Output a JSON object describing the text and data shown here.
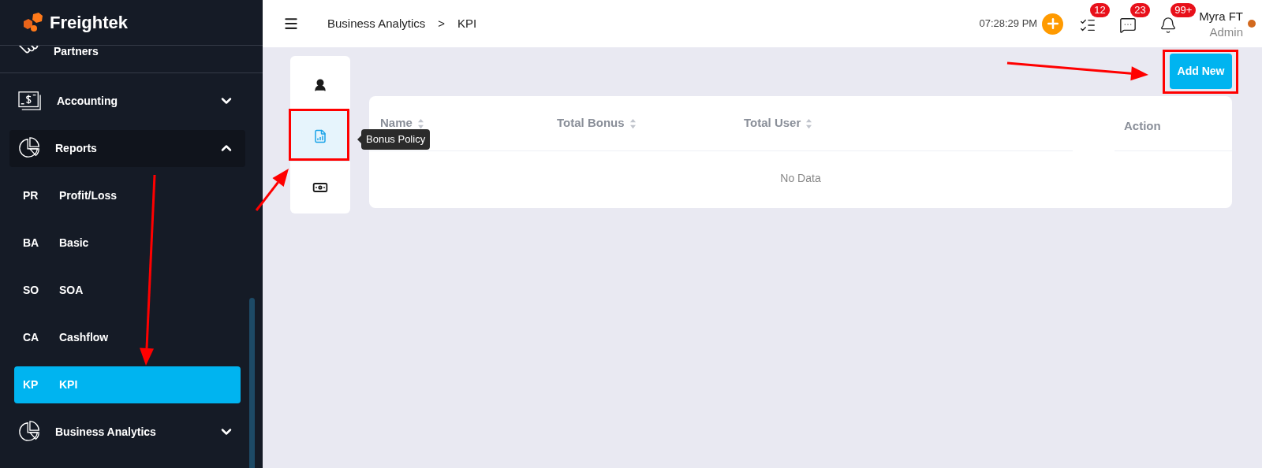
{
  "sidebar": {
    "logo": "Freightek",
    "items": [
      {
        "label": "Partners"
      },
      {
        "label": "Accounting",
        "expanded": false
      },
      {
        "label": "Reports",
        "expanded": true,
        "children": [
          {
            "abbr": "PR",
            "label": "Profit/Loss",
            "selected": false
          },
          {
            "abbr": "BA",
            "label": "Basic",
            "selected": false
          },
          {
            "abbr": "SO",
            "label": "SOA",
            "selected": false
          },
          {
            "abbr": "CA",
            "label": "Cashflow",
            "selected": false
          },
          {
            "abbr": "KP",
            "label": "KPI",
            "selected": true
          }
        ]
      },
      {
        "label": "Business Analytics",
        "expanded": false
      }
    ]
  },
  "header": {
    "breadcrumb": [
      "Business Analytics",
      "KPI"
    ],
    "separator": ">",
    "time": "07:28:29 PM",
    "notifications": [
      {
        "count": "12"
      },
      {
        "count": "23"
      },
      {
        "count": "99+"
      }
    ],
    "user": {
      "name": "Myra FT",
      "role": "Admin"
    }
  },
  "side_tabs": [
    {
      "selected": false
    },
    {
      "selected": true
    },
    {
      "selected": false
    }
  ],
  "tooltip": "Bonus Policy",
  "add_button": "Add New",
  "table": {
    "columns": [
      {
        "label": "Name",
        "sortable": true
      },
      {
        "label": "Total Bonus",
        "sortable": true
      },
      {
        "label": "Total User",
        "sortable": true
      },
      {
        "label": "Action",
        "sortable": false
      }
    ],
    "empty_text": "No Data"
  }
}
